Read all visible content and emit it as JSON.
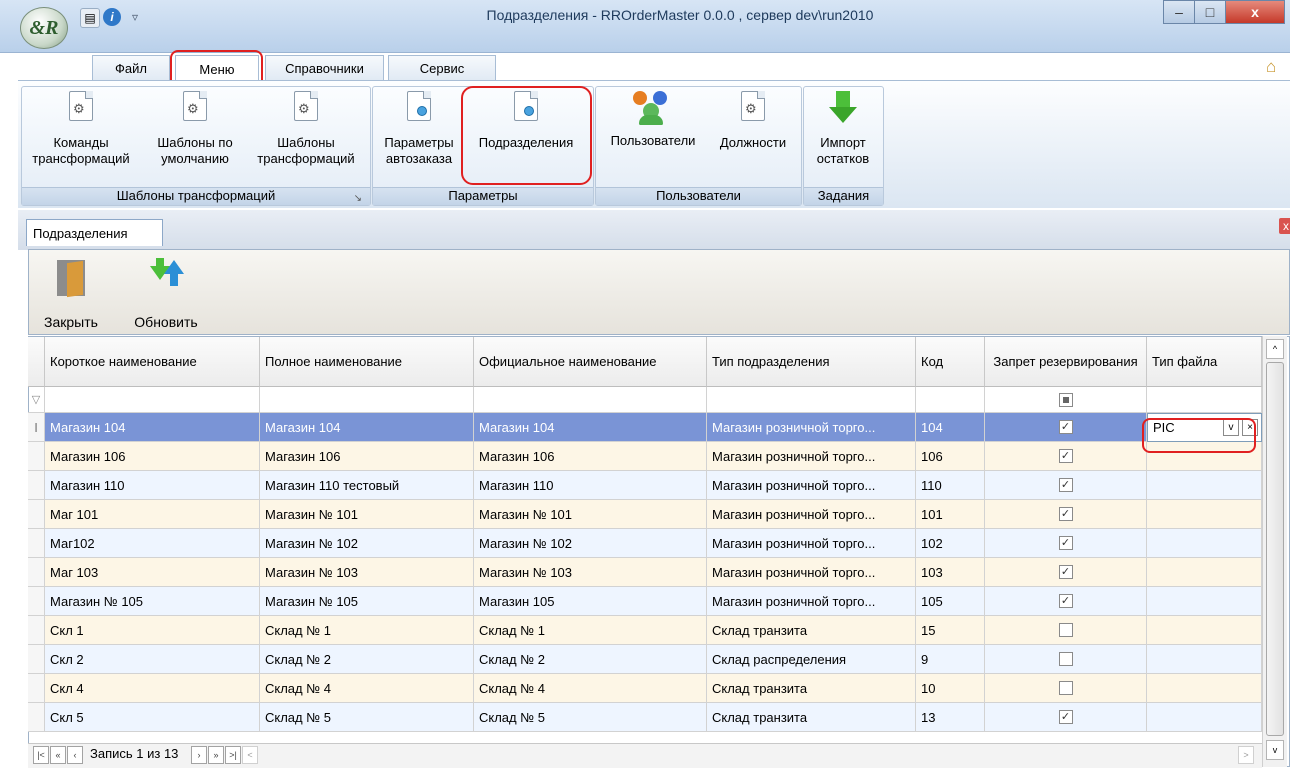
{
  "window": {
    "title": "Подразделения - RROrderMaster 0.0.0 , сервер dev\\run2010",
    "logo_text": "&R",
    "controls": {
      "minimize": "–",
      "maximize": "□",
      "close": "x"
    }
  },
  "ribbon_tabs": [
    "Файл",
    "Меню",
    "Справочники",
    "Сервис"
  ],
  "active_tab": "Меню",
  "ribbon": {
    "groups": [
      {
        "label": "Шаблоны трансформаций",
        "buttons": [
          {
            "line1": "Команды",
            "line2": "трансформаций",
            "icon": "gear-document-icon"
          },
          {
            "line1": "Шаблоны по",
            "line2": "умолчанию",
            "icon": "gear-document-icon"
          },
          {
            "line1": "Шаблоны",
            "line2": "трансформаций",
            "icon": "gear-document-icon"
          }
        ]
      },
      {
        "label": "Параметры",
        "buttons": [
          {
            "line1": "Параметры",
            "line2": "автозаказа",
            "icon": "document-icon"
          },
          {
            "line1": "Подразделения",
            "line2": "",
            "icon": "document-icon"
          }
        ]
      },
      {
        "label": "Пользователи",
        "buttons": [
          {
            "line1": "Пользователи",
            "line2": "",
            "icon": "users-icon"
          },
          {
            "line1": "Должности",
            "line2": "",
            "icon": "gear-document-icon"
          }
        ]
      },
      {
        "label": "Задания",
        "buttons": [
          {
            "line1": "Импорт",
            "line2": "остатков",
            "icon": "import-arrow-icon"
          }
        ]
      }
    ]
  },
  "document_tab": {
    "label": "Подразделения",
    "close": "x"
  },
  "toolbar": {
    "close_label": "Закрыть",
    "refresh_label": "Обновить"
  },
  "grid": {
    "columns": [
      "Короткое наименование",
      "Полное наименование",
      "Официальное наименование",
      "Тип подразделения",
      "Код",
      "Запрет резервирования",
      "Тип файла"
    ],
    "rows": [
      {
        "short": "Магазин 104",
        "full": "Магазин 104",
        "official": "Магазин 104",
        "type": "Магазин розничной торго...",
        "code": "104",
        "no_reserve": true,
        "file_type": "PIC",
        "selected": true
      },
      {
        "short": "Магазин 106",
        "full": "Магазин 106",
        "official": "Магазин 106",
        "type": "Магазин розничной торго...",
        "code": "106",
        "no_reserve": true,
        "file_type": ""
      },
      {
        "short": "Магазин 110",
        "full": "Магазин 110 тестовый",
        "official": "Магазин 110",
        "type": "Магазин розничной торго...",
        "code": "110",
        "no_reserve": true,
        "file_type": ""
      },
      {
        "short": "Маг 101",
        "full": "Магазин № 101",
        "official": "Магазин № 101",
        "type": "Магазин розничной торго...",
        "code": "101",
        "no_reserve": true,
        "file_type": ""
      },
      {
        "short": "Маг102",
        "full": "Магазин № 102",
        "official": "Магазин № 102",
        "type": "Магазин розничной торго...",
        "code": "102",
        "no_reserve": true,
        "file_type": ""
      },
      {
        "short": "Маг 103",
        "full": "Магазин № 103",
        "official": "Магазин № 103",
        "type": "Магазин розничной торго...",
        "code": "103",
        "no_reserve": true,
        "file_type": ""
      },
      {
        "short": "Магазин № 105",
        "full": "Магазин № 105",
        "official": "Магазин 105",
        "type": "Магазин розничной торго...",
        "code": "105",
        "no_reserve": true,
        "file_type": ""
      },
      {
        "short": "Скл 1",
        "full": "Склад № 1",
        "official": "Склад № 1",
        "type": "Склад транзита",
        "code": "15",
        "no_reserve": false,
        "file_type": ""
      },
      {
        "short": "Скл 2",
        "full": "Склад № 2",
        "official": "Склад № 2",
        "type": "Склад распределения",
        "code": "9",
        "no_reserve": false,
        "file_type": ""
      },
      {
        "short": "Скл 4",
        "full": "Склад № 4",
        "official": "Склад № 4",
        "type": "Склад транзита",
        "code": "10",
        "no_reserve": false,
        "file_type": ""
      },
      {
        "short": "Скл 5",
        "full": "Склад № 5",
        "official": "Склад № 5",
        "type": "Склад транзита",
        "code": "13",
        "no_reserve": true,
        "file_type": ""
      }
    ]
  },
  "pager": {
    "record_text": "Запись 1 из 13"
  },
  "colors": {
    "selected_row": "#7a94d6",
    "alt_row": "#fdf6e6",
    "row": "#eef5ff",
    "highlight": "#e02020"
  }
}
